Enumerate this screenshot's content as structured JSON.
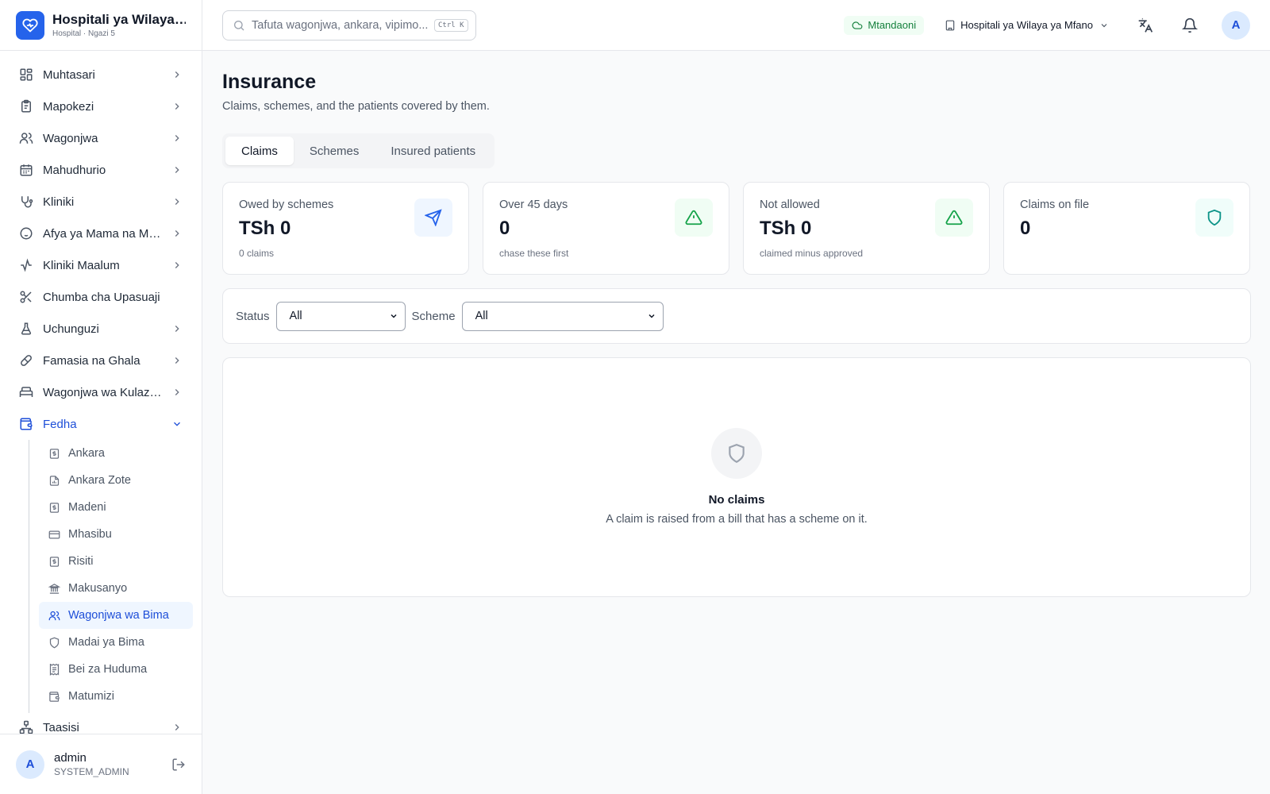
{
  "brand": {
    "title": "Hospitali ya Wilaya ya Mfano",
    "subtitle": "Hospital · Ngazi 5",
    "color": "#2563eb"
  },
  "sidebar": {
    "items": [
      {
        "label": "Muhtasari",
        "icon": "grid-icon"
      },
      {
        "label": "Mapokezi",
        "icon": "clipboard-icon"
      },
      {
        "label": "Wagonjwa",
        "icon": "users-icon"
      },
      {
        "label": "Mahudhurio",
        "icon": "calendar-icon"
      },
      {
        "label": "Kliniki",
        "icon": "stethoscope-icon"
      },
      {
        "label": "Afya ya Mama na Mtoto",
        "icon": "baby-icon"
      },
      {
        "label": "Kliniki Maalum",
        "icon": "activity-icon"
      },
      {
        "label": "Chumba cha Upasuaji",
        "icon": "scissors-icon"
      },
      {
        "label": "Uchunguzi",
        "icon": "flask-icon"
      },
      {
        "label": "Famasia na Ghala",
        "icon": "pill-icon"
      },
      {
        "label": "Wagonjwa wa Kulazwa",
        "icon": "bed-icon"
      },
      {
        "label": "Fedha",
        "icon": "wallet-icon"
      },
      {
        "label": "Taasisi",
        "icon": "network-icon"
      }
    ],
    "finance_sub": [
      {
        "label": "Ankara",
        "icon": "dollar-doc-icon"
      },
      {
        "label": "Ankara Zote",
        "icon": "file-chart-icon"
      },
      {
        "label": "Madeni",
        "icon": "dollar-doc-icon"
      },
      {
        "label": "Mhasibu",
        "icon": "card-icon"
      },
      {
        "label": "Risiti",
        "icon": "dollar-doc-icon"
      },
      {
        "label": "Makusanyo",
        "icon": "bank-icon"
      },
      {
        "label": "Wagonjwa wa Bima",
        "icon": "users-icon"
      },
      {
        "label": "Madai ya Bima",
        "icon": "shield-icon"
      },
      {
        "label": "Bei za Huduma",
        "icon": "receipt-icon"
      },
      {
        "label": "Matumizi",
        "icon": "wallet-icon"
      }
    ]
  },
  "user": {
    "initial": "A",
    "name": "admin",
    "role": "SYSTEM_ADMIN"
  },
  "header": {
    "search_placeholder": "Tafuta wagonjwa, ankara, vipimo...",
    "shortcut": "Ctrl K",
    "status": "Mtandaoni",
    "facility": "Hospitali ya Wilaya ya Mfano",
    "avatar_initial": "A"
  },
  "page": {
    "title": "Insurance",
    "subtitle": "Claims, schemes, and the patients covered by them."
  },
  "tabs": [
    "Claims",
    "Schemes",
    "Insured patients"
  ],
  "stats": [
    {
      "label": "Owed by schemes",
      "value": "TSh 0",
      "hint": "0 claims",
      "icon": "send-icon",
      "icon_color": "#2563eb",
      "icon_bg": "#eff6ff"
    },
    {
      "label": "Over 45 days",
      "value": "0",
      "hint": "chase these first",
      "icon": "warning-icon",
      "icon_color": "#16a34a",
      "icon_bg": "#f0fdf4"
    },
    {
      "label": "Not allowed",
      "value": "TSh 0",
      "hint": "claimed minus approved",
      "icon": "warning-icon",
      "icon_color": "#16a34a",
      "icon_bg": "#f0fdf4"
    },
    {
      "label": "Claims on file",
      "value": "0",
      "hint": "",
      "icon": "shield-icon",
      "icon_color": "#0d9488",
      "icon_bg": "#f0fdfa"
    }
  ],
  "filters": {
    "status_label": "Status",
    "status_value": "All",
    "scheme_label": "Scheme",
    "scheme_value": "All"
  },
  "empty": {
    "title": "No claims",
    "text": "A claim is raised from a bill that has a scheme on it."
  }
}
